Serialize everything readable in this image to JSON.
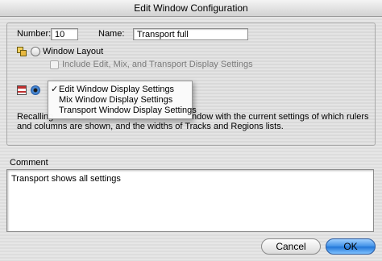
{
  "window": {
    "title": "Edit Window Configuration"
  },
  "config": {
    "number_label": "Number:",
    "number_value": "10",
    "name_label": "Name:",
    "name_value": "Transport full"
  },
  "options": {
    "window_layout_label": "Window Layout",
    "include_settings_label": "Include Edit, Mix, and Transport Display Settings"
  },
  "display_menu": {
    "selected": "Edit Window Display Settings",
    "items": [
      {
        "label": "Edit Window Display Settings",
        "checked": "✓"
      },
      {
        "label": "Mix Window Display Settings",
        "checked": ""
      },
      {
        "label": "Transport Window Display Settings",
        "checked": ""
      }
    ]
  },
  "description": {
    "line1_start": "Recalling",
    "line1_end": "ndow with the current settings of which rulers",
    "line2": "and columns are shown, and the widths of Tracks and Regions lists."
  },
  "comment": {
    "label": "Comment",
    "value": "Transport shows all settings"
  },
  "buttons": {
    "cancel": "Cancel",
    "ok": "OK"
  },
  "icons": {
    "window_layout": "window-layout-icon",
    "edit_window": "edit-window-icon"
  },
  "colors": {
    "accent": "#2f6fc0",
    "ok_button": "#3e8fe6"
  }
}
